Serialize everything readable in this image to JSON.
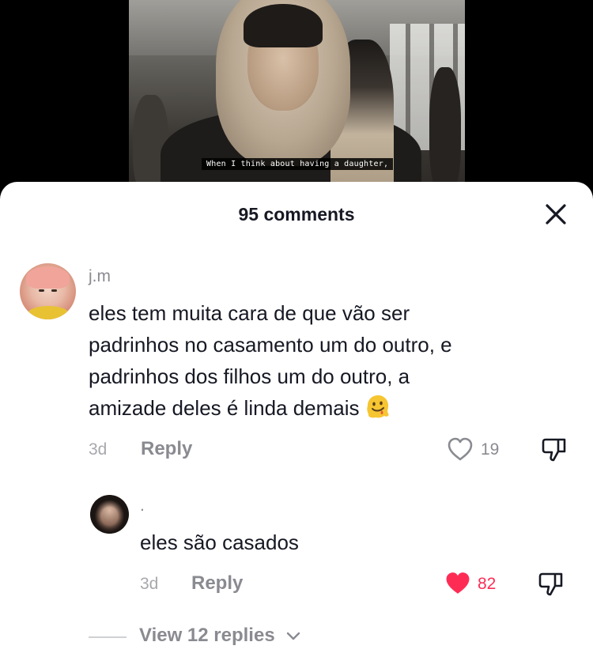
{
  "video": {
    "subtitle": "When I think about having a daughter,"
  },
  "comments_sheet": {
    "title": "95 comments",
    "close_icon": "close-icon"
  },
  "comments": [
    {
      "username": "j.m",
      "lines": [
        "eles tem muita cara de que vão ser",
        "padrinhos no casamento um do outro, e",
        "padrinhos dos filhos um do outro, a",
        "amizade deles é linda demais"
      ],
      "emoji": "melting-face-emoji",
      "date": "3d",
      "reply_label": "Reply",
      "likes": "19",
      "liked": false
    },
    {
      "username": ".",
      "lines": [
        "eles são casados"
      ],
      "date": "3d",
      "reply_label": "Reply",
      "likes": "82",
      "liked": true
    }
  ],
  "view_replies": {
    "label": "View 12 replies"
  },
  "colors": {
    "liked": "#fe2c55",
    "muted": "#8a8b91",
    "text": "#161823"
  }
}
